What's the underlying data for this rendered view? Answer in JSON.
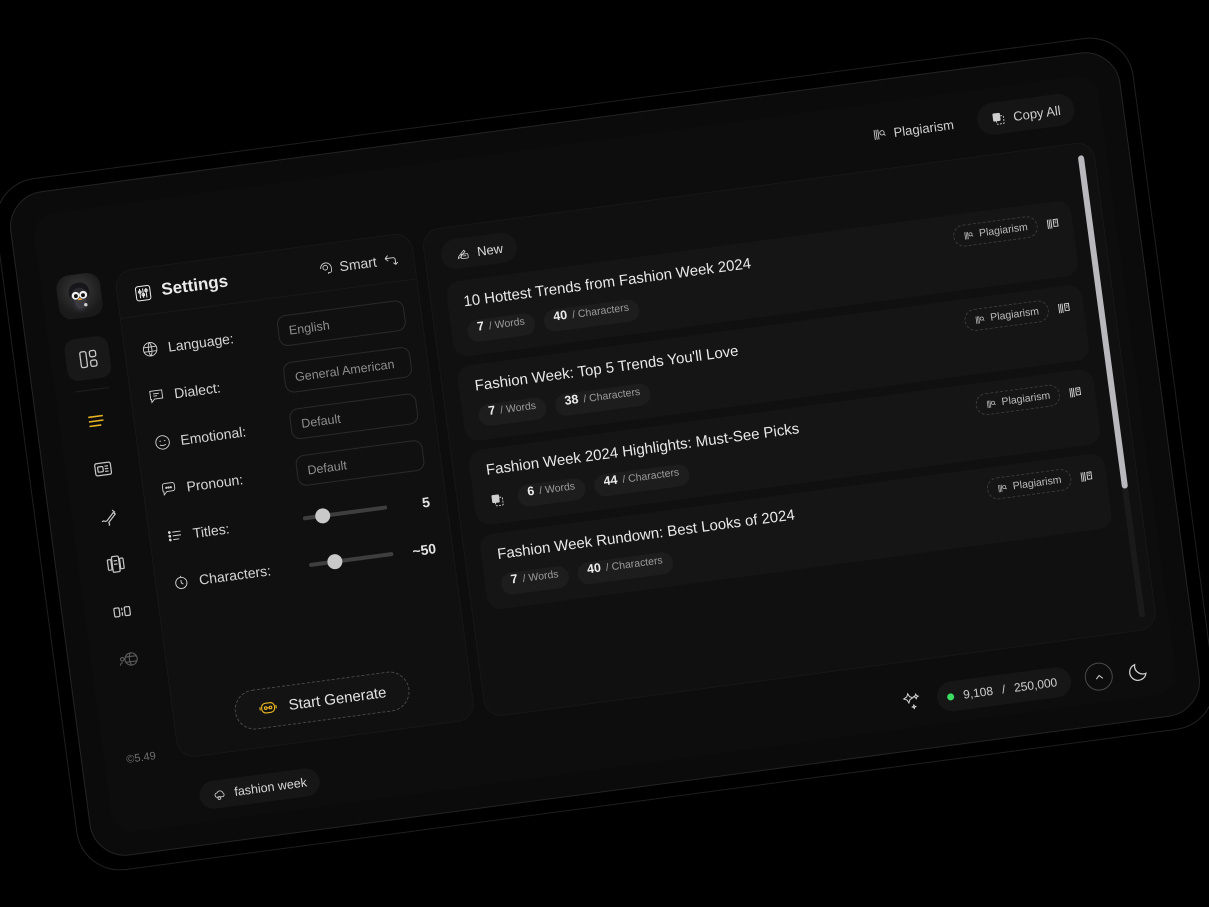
{
  "app": {
    "version_label": "©5.49"
  },
  "topbar": {
    "plagiarism_label": "Plagiarism",
    "copy_all_label": "Copy All"
  },
  "sidebar": {
    "avatar_name": "penguin-avatar",
    "items": [
      {
        "name": "dashboard",
        "icon": "dashboard-grid-icon"
      },
      {
        "name": "titles",
        "icon": "lines-icon"
      },
      {
        "name": "article",
        "icon": "newspaper-icon"
      },
      {
        "name": "rewrite",
        "icon": "pencil-icon"
      },
      {
        "name": "templates",
        "icon": "layout-columns-icon"
      },
      {
        "name": "compare",
        "icon": "split-icon"
      },
      {
        "name": "audience",
        "icon": "globe-person-icon"
      }
    ]
  },
  "settings": {
    "title": "Settings",
    "smart_label": "Smart",
    "fields": [
      {
        "label": "Language:",
        "value": "English",
        "icon": "globe-icon"
      },
      {
        "label": "Dialect:",
        "value": "General American",
        "icon": "speech-lines-icon"
      },
      {
        "label": "Emotional:",
        "value": "Default",
        "icon": "emoji-icon"
      },
      {
        "label": "Pronoun:",
        "value": "Default",
        "icon": "speech-dots-icon"
      }
    ],
    "sliders": [
      {
        "label": "Titles:",
        "value": "5",
        "percent": 24,
        "icon": "list-icon"
      },
      {
        "label": "Characters:",
        "value": "~50",
        "percent": 30,
        "icon": "clock-icon"
      }
    ],
    "generate_label": "Start Generate"
  },
  "results": {
    "tab_label": "New",
    "row_plagiarism_label": "Plagiarism",
    "words_unit": "/ Words",
    "characters_unit": "/ Characters",
    "items": [
      {
        "title": "10 Hottest Trends from Fashion Week 2024",
        "words": "7",
        "characters": "40",
        "has_copy": false
      },
      {
        "title": "Fashion Week: Top 5 Trends You'll Love",
        "words": "7",
        "characters": "38",
        "has_copy": false
      },
      {
        "title": "Fashion Week 2024 Highlights: Must-See Picks",
        "words": "6",
        "characters": "44",
        "has_copy": true
      },
      {
        "title": "Fashion Week Rundown: Best Looks of 2024",
        "words": "7",
        "characters": "40",
        "has_copy": false
      }
    ]
  },
  "bottombar": {
    "tag_label": "fashion week",
    "credits_used": "9,108",
    "credits_separator": "/",
    "credits_total": "250,000"
  },
  "colors": {
    "accent": "#e8b422",
    "status_online": "#3ddc62",
    "surface": "#101010",
    "card": "#151515"
  }
}
